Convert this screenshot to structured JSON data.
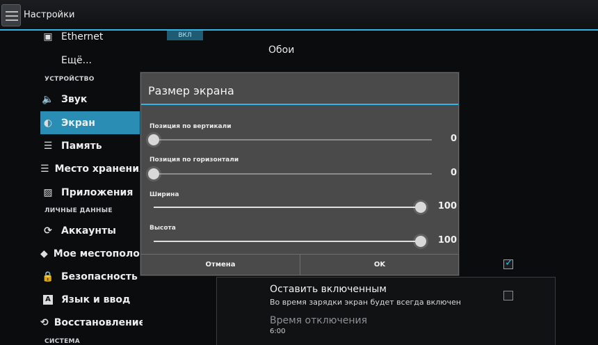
{
  "actionbar": {
    "title": "Настройки",
    "icon": "settings-app-icon"
  },
  "sidebar": {
    "items_top": [
      {
        "label": "Ethernet",
        "icon": "ethernet-icon",
        "toggle": "ВКЛ"
      },
      {
        "label": "Ещё..."
      }
    ],
    "header_device": "УСТРОЙСТВО",
    "items_device": [
      {
        "label": "Звук",
        "icon": "speaker-icon"
      },
      {
        "label": "Экран",
        "icon": "brightness-icon"
      },
      {
        "label": "Память",
        "icon": "storage-icon"
      },
      {
        "label": "Место хранения",
        "icon": "storage-icon"
      },
      {
        "label": "Приложения",
        "icon": "apps-icon"
      }
    ],
    "header_personal": "ЛИЧНЫЕ ДАННЫЕ",
    "items_personal": [
      {
        "label": "Аккаунты",
        "icon": "sync-icon"
      },
      {
        "label": "Мое местоположение",
        "icon": "location-icon"
      },
      {
        "label": "Безопасность",
        "icon": "lock-icon"
      },
      {
        "label": "Язык и ввод",
        "icon": "keyboard-a-icon"
      },
      {
        "label": "Восстановление и сброс",
        "icon": "restore-icon"
      }
    ],
    "header_system": "СИСТЕМА"
  },
  "panel": {
    "wallpaper_label": "Обои",
    "stay_awake": {
      "title": "Оставить включенным",
      "summary": "Во время зарядки экран будет всегда включен",
      "checked": false
    },
    "sleep": {
      "title": "Время отключения",
      "value": "6:00"
    },
    "hidden_checkbox_checked": true
  },
  "dialog": {
    "title": "Размер экрана",
    "sliders": [
      {
        "label": "Позиция по вертикали",
        "value": "0",
        "fraction": 0.0
      },
      {
        "label": "Позиция по горизонтали",
        "value": "0",
        "fraction": 0.0
      },
      {
        "label": "Ширина",
        "value": "100",
        "fraction": 1.0
      },
      {
        "label": "Высота",
        "value": "100",
        "fraction": 1.0
      }
    ],
    "cancel_label": "Отмена",
    "ok_label": "OK"
  },
  "colors": {
    "accent": "#33b5e5",
    "selected_item": "#2a8db3",
    "dialog_bg": "#4a4a4b"
  }
}
